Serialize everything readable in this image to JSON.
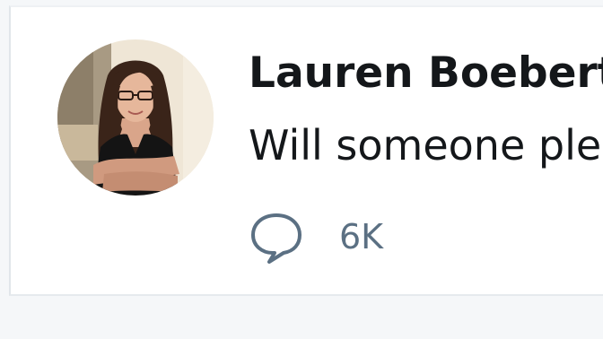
{
  "tweet": {
    "author_name": "Lauren Boebert",
    "text": "Will someone ple",
    "avatar_icon": "profile-photo",
    "reply_icon": "comment-bubble-icon",
    "reply_count": "6K"
  },
  "colors": {
    "text_primary": "#14171a",
    "text_secondary": "#5b7083",
    "card_background": "#ffffff",
    "page_background": "#f5f7f9"
  }
}
